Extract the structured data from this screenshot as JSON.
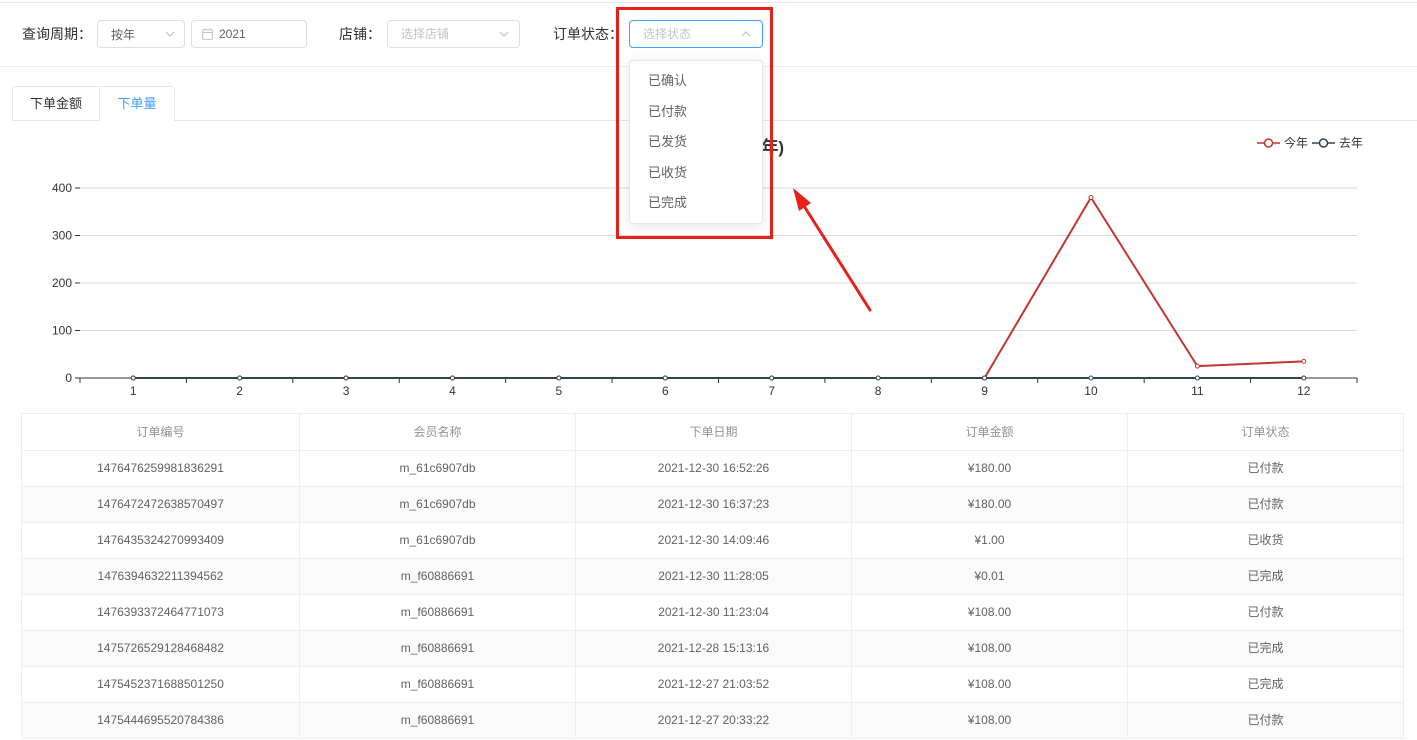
{
  "filters": {
    "period": {
      "label": "查询周期：",
      "value": "按年"
    },
    "year": {
      "value": "2021"
    },
    "shop": {
      "label": "店铺：",
      "placeholder": "选择店铺"
    },
    "status": {
      "label": "订单状态：",
      "placeholder": "选择状态",
      "dropdown_open": true,
      "options": [
        "已确认",
        "已付款",
        "已发货",
        "已收货",
        "已完成"
      ]
    }
  },
  "tabs": [
    {
      "label": "下单金额",
      "active": false
    },
    {
      "label": "下单量",
      "active": true
    }
  ],
  "chart_data": {
    "type": "line",
    "title": "年)",
    "categories": [
      "1",
      "2",
      "3",
      "4",
      "5",
      "6",
      "7",
      "8",
      "9",
      "10",
      "11",
      "12"
    ],
    "series": [
      {
        "name": "今年",
        "color": "#c23531",
        "values": [
          0,
          0,
          0,
          0,
          0,
          0,
          0,
          0,
          0,
          380,
          25,
          35
        ]
      },
      {
        "name": "去年",
        "color": "#2f4554",
        "values": [
          0,
          0,
          0,
          0,
          0,
          0,
          0,
          0,
          0,
          0,
          0,
          0
        ]
      }
    ],
    "ylim": [
      0,
      400
    ],
    "yticks": [
      0,
      100,
      200,
      300,
      400
    ],
    "grid": true,
    "legend": "top-right"
  },
  "table": {
    "columns": [
      "订单编号",
      "会员名称",
      "下单日期",
      "订单金额",
      "订单状态"
    ],
    "rows": [
      [
        "1476476259981836291",
        "m_61c6907db",
        "2021-12-30 16:52:26",
        "¥180.00",
        "已付款"
      ],
      [
        "1476472472638570497",
        "m_61c6907db",
        "2021-12-30 16:37:23",
        "¥180.00",
        "已付款"
      ],
      [
        "1476435324270993409",
        "m_61c6907db",
        "2021-12-30 14:09:46",
        "¥1.00",
        "已收货"
      ],
      [
        "1476394632211394562",
        "m_f60886691",
        "2021-12-30 11:28:05",
        "¥0.01",
        "已完成"
      ],
      [
        "1476393372464771073",
        "m_f60886691",
        "2021-12-30 11:23:04",
        "¥108.00",
        "已付款"
      ],
      [
        "1475726529128468482",
        "m_f60886691",
        "2021-12-28 15:13:16",
        "¥108.00",
        "已完成"
      ],
      [
        "1475452371688501250",
        "m_f60886691",
        "2021-12-27 21:03:52",
        "¥108.00",
        "已完成"
      ],
      [
        "1475444695520784386",
        "m_f60886691",
        "2021-12-27 20:33:22",
        "¥108.00",
        "已付款"
      ]
    ]
  },
  "icons": {
    "period_select": "chevron-down-icon",
    "year_picker": "calendar-icon",
    "shop_select": "chevron-down-icon",
    "status_select": "chevron-up-icon"
  },
  "colors": {
    "primary": "#409eff",
    "annotation": "#e8201a"
  }
}
